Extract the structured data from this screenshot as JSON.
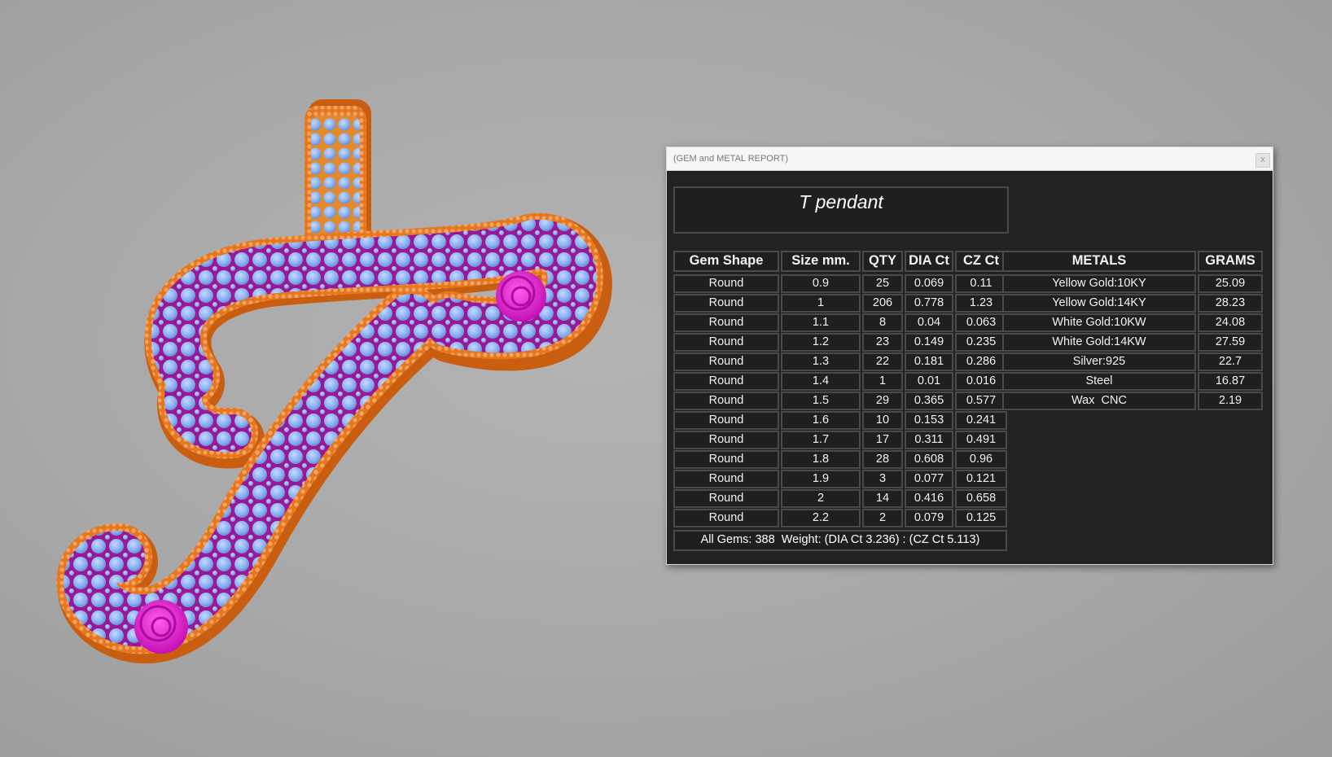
{
  "window": {
    "title": "(GEM and METAL REPORT)",
    "close_label": "x"
  },
  "report": {
    "pendant_name": "T pendant",
    "gem_headers": [
      "Gem Shape",
      "Size mm.",
      "QTY",
      "DIA Ct",
      "CZ Ct"
    ],
    "gem_rows": [
      [
        "Round",
        "0.9",
        "25",
        "0.069",
        "0.11"
      ],
      [
        "Round",
        "1",
        "206",
        "0.778",
        "1.23"
      ],
      [
        "Round",
        "1.1",
        "8",
        "0.04",
        "0.063"
      ],
      [
        "Round",
        "1.2",
        "23",
        "0.149",
        "0.235"
      ],
      [
        "Round",
        "1.3",
        "22",
        "0.181",
        "0.286"
      ],
      [
        "Round",
        "1.4",
        "1",
        "0.01",
        "0.016"
      ],
      [
        "Round",
        "1.5",
        "29",
        "0.365",
        "0.577"
      ],
      [
        "Round",
        "1.6",
        "10",
        "0.153",
        "0.241"
      ],
      [
        "Round",
        "1.7",
        "17",
        "0.311",
        "0.491"
      ],
      [
        "Round",
        "1.8",
        "28",
        "0.608",
        "0.96"
      ],
      [
        "Round",
        "1.9",
        "3",
        "0.077",
        "0.121"
      ],
      [
        "Round",
        "2",
        "14",
        "0.416",
        "0.658"
      ],
      [
        "Round",
        "2.2",
        "2",
        "0.079",
        "0.125"
      ]
    ],
    "summary": "All Gems: 388  Weight: (DIA Ct 3.236) : (CZ Ct 5.113)",
    "metal_headers": [
      "METALS",
      "GRAMS"
    ],
    "metal_rows": [
      [
        "Yellow Gold:10KY",
        "25.09"
      ],
      [
        "Yellow Gold:14KY",
        "28.23"
      ],
      [
        "White Gold:10KW",
        "24.08"
      ],
      [
        "White Gold:14KW",
        "27.59"
      ],
      [
        "Silver:925",
        "22.7"
      ],
      [
        "Steel",
        "16.87"
      ],
      [
        "Wax  CNC",
        "2.19"
      ]
    ]
  },
  "colors": {
    "background": "#a9a9a9",
    "panel": "#222222",
    "cell_border": "#4a4a4a",
    "metal_gold": "#e8761a",
    "enamel_magenta": "#a0189a",
    "gem_blue": "#8fb4f0",
    "rose_magenta": "#e020d0"
  }
}
